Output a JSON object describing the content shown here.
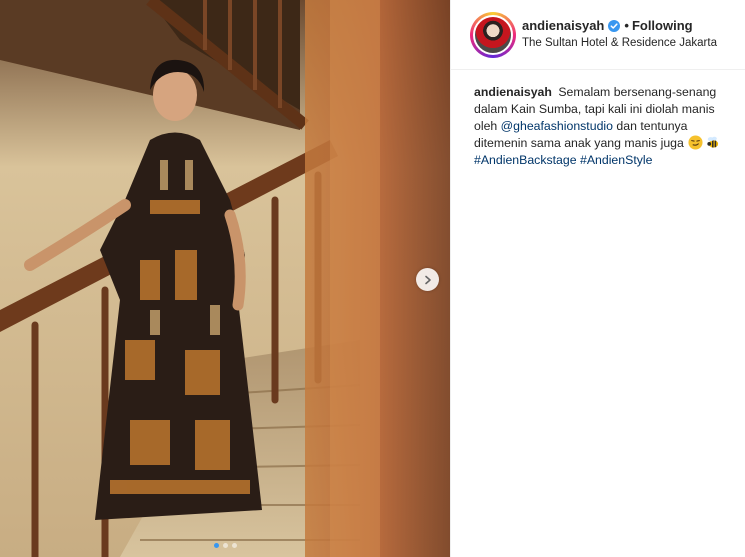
{
  "post": {
    "author": {
      "username": "andienaisyah",
      "verified": true,
      "follow_state": "Following",
      "separator": "•",
      "location": "The Sultan Hotel & Residence Jakarta"
    },
    "caption": {
      "username": "andienaisyah",
      "text_1": "Semalam bersenang-senang dalam Kain Sumba, tapi kali ini diolah manis oleh",
      "mention": "@gheafashionstudio",
      "text_2": "dan tentunya ditemenin sama anak yang manis juga",
      "emojis": [
        "smirk-emoji",
        "bee-emoji"
      ],
      "hashtags": [
        "#AndienBackstage",
        "#AndienStyle"
      ]
    },
    "carousel": {
      "total_slides": 3,
      "active_slide": 1
    },
    "colors": {
      "verified_blue": "#3897f0",
      "link_blue": "#003569",
      "text": "#262626",
      "border": "#efefef"
    }
  }
}
